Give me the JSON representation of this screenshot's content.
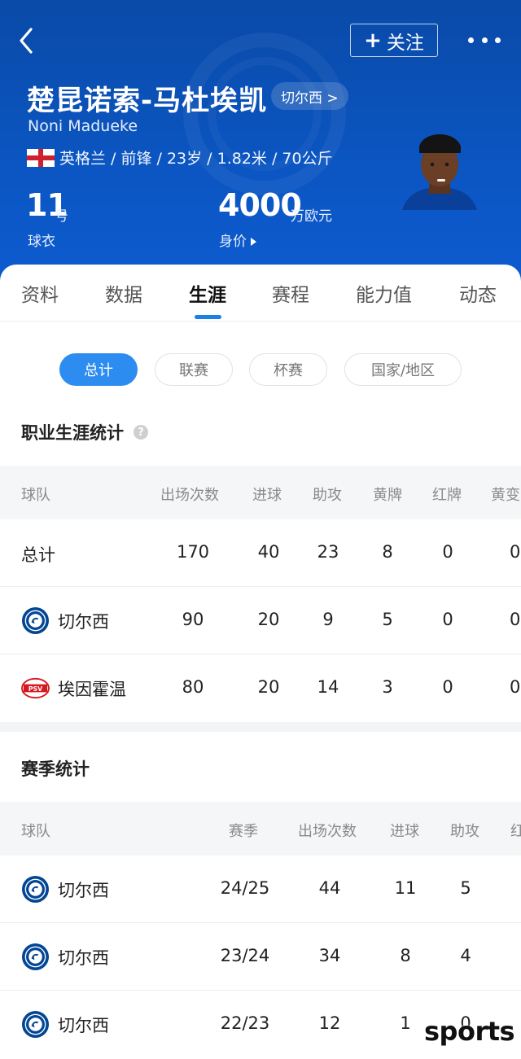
{
  "header": {
    "follow_label": "关注",
    "player_name": "楚昆诺索-马杜埃凯",
    "club_chip": "切尔西 >",
    "player_name_en": "Noni Madueke",
    "meta": "英格兰 / 前锋 / 23岁 / 1.82米 / 70公斤",
    "shirt_number": "11",
    "shirt_unit": "号",
    "shirt_label": "球衣",
    "market_value": "4000",
    "market_unit": "万欧元",
    "market_label": "身价"
  },
  "tabs": [
    "资料",
    "数据",
    "生涯",
    "赛程",
    "能力值",
    "动态"
  ],
  "active_tab": "生涯",
  "filters": [
    "总计",
    "联赛",
    "杯赛",
    "国家/地区"
  ],
  "active_filter": "总计",
  "career": {
    "title": "职业生涯统计",
    "columns": [
      "球队",
      "出场次数",
      "进球",
      "助攻",
      "黄牌",
      "红牌",
      "黄变"
    ],
    "rows": [
      {
        "team": "总计",
        "apps": "170",
        "goals": "40",
        "assists": "23",
        "yellow": "8",
        "red": "0",
        "yr": "0"
      },
      {
        "team": "切尔西",
        "apps": "90",
        "goals": "20",
        "assists": "9",
        "yellow": "5",
        "red": "0",
        "yr": "0"
      },
      {
        "team": "埃因霍温",
        "apps": "80",
        "goals": "20",
        "assists": "14",
        "yellow": "3",
        "red": "0",
        "yr": "0"
      }
    ]
  },
  "season": {
    "title": "赛季统计",
    "columns": [
      "球队",
      "赛季",
      "出场次数",
      "进球",
      "助攻",
      "红"
    ],
    "rows": [
      {
        "team": "切尔西",
        "season": "24/25",
        "apps": "44",
        "goals": "11",
        "assists": "5"
      },
      {
        "team": "切尔西",
        "season": "23/24",
        "apps": "34",
        "goals": "8",
        "assists": "4"
      },
      {
        "team": "切尔西",
        "season": "22/23",
        "apps": "12",
        "goals": "1",
        "assists": "0"
      }
    ]
  },
  "watermark": "sports",
  "colors": {
    "header_blue": "#0b55c0",
    "accent": "#2d8cf0",
    "chelsea_blue": "#034694",
    "psv_red": "#d51920"
  }
}
